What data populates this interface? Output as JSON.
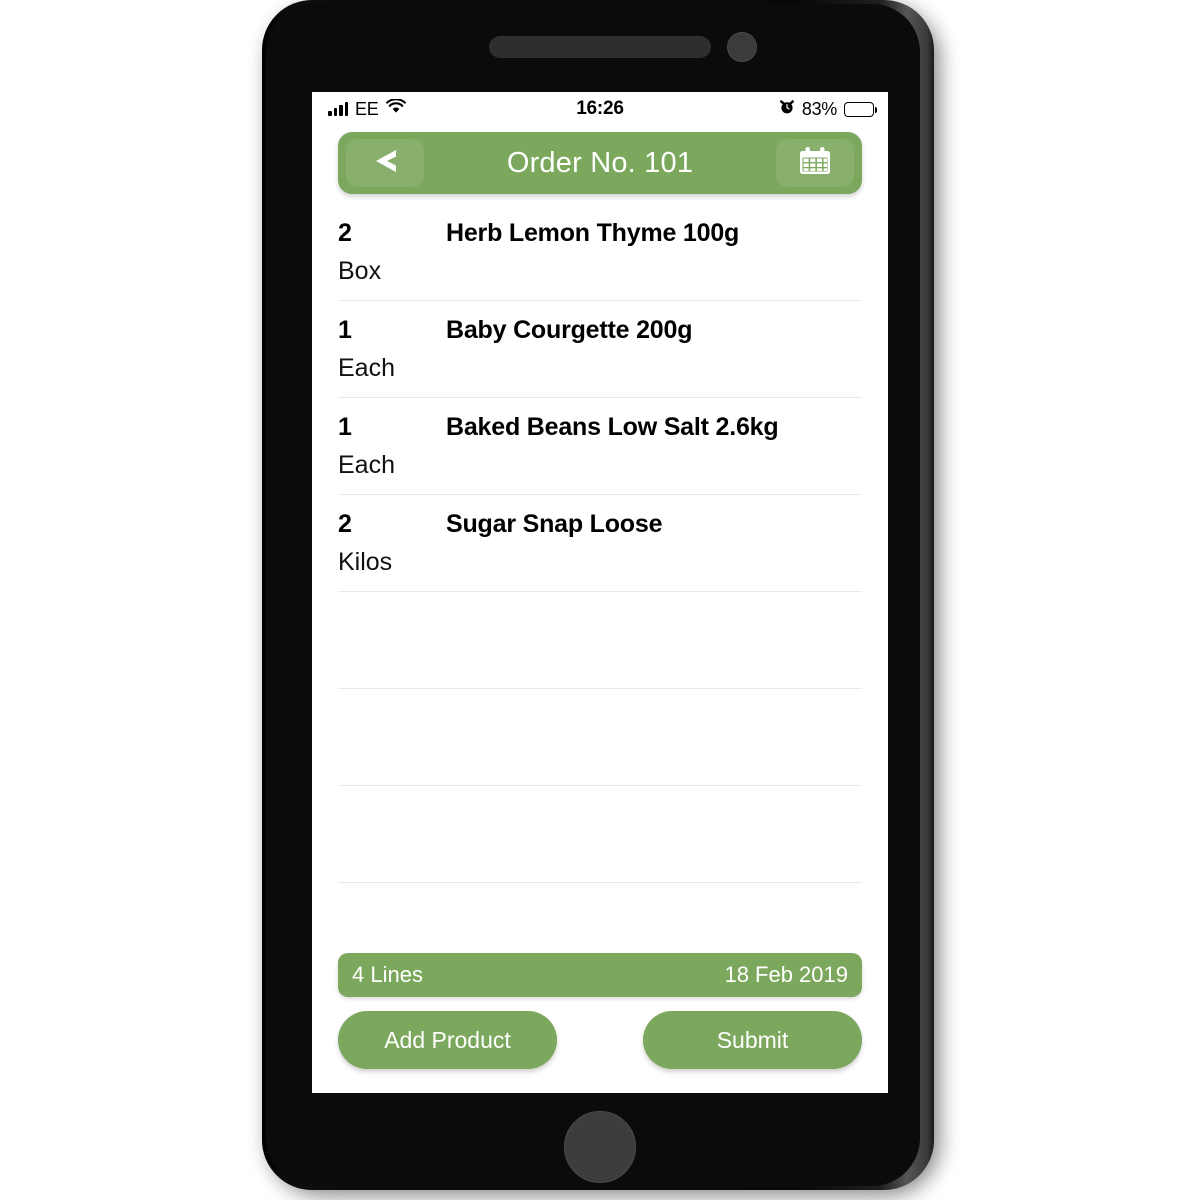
{
  "theme": {
    "accent_green": "#7BA85C",
    "screen_bg": "#ffffff",
    "text_dark": "#000000",
    "divider": "#e9e9e9",
    "phone_body": "#0b0b0b"
  },
  "status_bar": {
    "signal_icon": "signal-bars-icon",
    "carrier": "EE",
    "wifi_icon": "wifi-icon",
    "time": "16:26",
    "alarm_icon": "alarm-clock-icon",
    "battery_percent": "83%",
    "battery_level": 83,
    "battery_icon": "battery-icon"
  },
  "header": {
    "back_icon": "back-chevron-icon",
    "title": "Order No. 101",
    "calendar_icon": "calendar-icon"
  },
  "list": {
    "columns": [
      "qty",
      "name",
      "unit"
    ],
    "rows": [
      {
        "qty": "2",
        "name": "Herb Lemon Thyme 100g",
        "unit": "Box"
      },
      {
        "qty": "1",
        "name": "Baby Courgette 200g",
        "unit": "Each"
      },
      {
        "qty": "1",
        "name": "Baked Beans Low Salt 2.6kg",
        "unit": "Each"
      },
      {
        "qty": "2",
        "name": "Sugar Snap Loose",
        "unit": "Kilos"
      }
    ],
    "empty_row_count": 4
  },
  "footer": {
    "lines_label": "4 Lines",
    "date": "18 Feb 2019",
    "add_product_label": "Add Product",
    "submit_label": "Submit"
  }
}
